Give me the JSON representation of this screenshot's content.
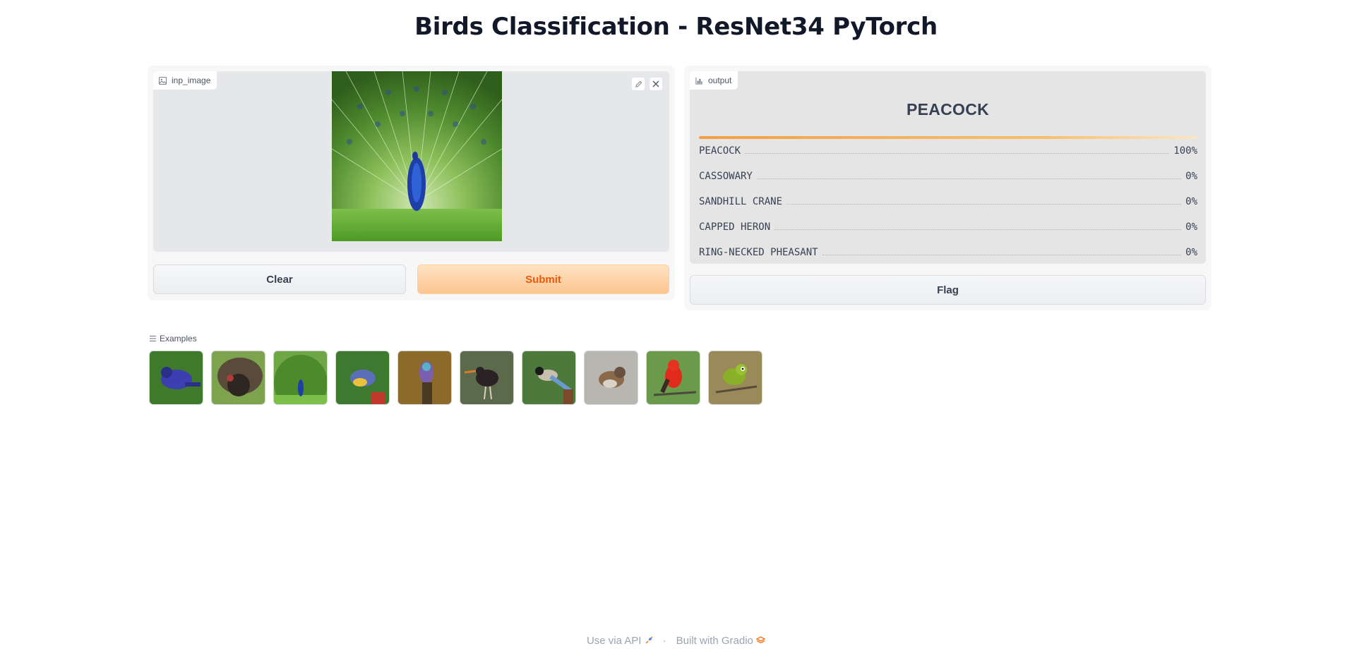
{
  "app": {
    "title": "Birds Classification - ResNet34 PyTorch"
  },
  "input": {
    "label": "inp_image",
    "label_icon": "image-icon",
    "edit_icon": "pencil-icon",
    "close_icon": "close-icon"
  },
  "buttons": {
    "clear": "Clear",
    "submit": "Submit",
    "flag": "Flag"
  },
  "output": {
    "label": "output",
    "label_icon": "bar-chart-icon",
    "top_label": "PEACOCK",
    "confidences": [
      {
        "label": "PEACOCK",
        "value": "100%",
        "fraction": 1.0
      },
      {
        "label": "CASSOWARY",
        "value": "0%",
        "fraction": 0
      },
      {
        "label": "SANDHILL CRANE",
        "value": "0%",
        "fraction": 0
      },
      {
        "label": "CAPPED HERON",
        "value": "0%",
        "fraction": 0
      },
      {
        "label": "RING-NECKED PHEASANT",
        "value": "0%",
        "fraction": 0
      }
    ]
  },
  "examples": {
    "label": "Examples",
    "label_icon": "list-icon",
    "count": 10
  },
  "footer": {
    "api_text": "Use via API",
    "api_icon": "rocket-icon",
    "separator": "·",
    "built_text": "Built with Gradio",
    "built_icon": "gradio-logo-icon"
  },
  "colors": {
    "accent": "#f97316",
    "submit_bg": "#fdd0a2",
    "panel_bg": "#f7f7f8"
  }
}
